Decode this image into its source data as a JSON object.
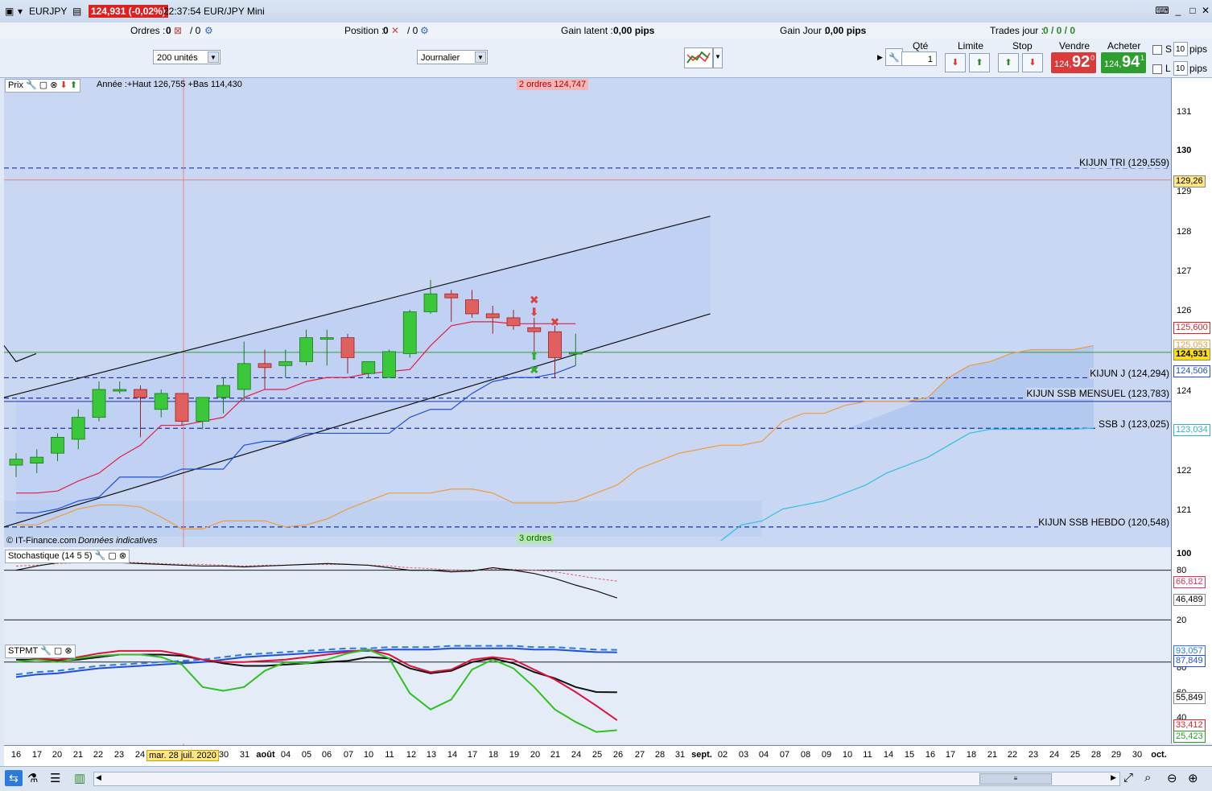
{
  "titlebar": {
    "symbol": "EURJPY",
    "price_badge": "124,931 (-0,02%)",
    "time_title": "22:37:54 EUR/JPY Mini"
  },
  "infobar": {
    "orders_label": "Ordres :",
    "orders_value": "0",
    "orders_sep": "/ 0",
    "position_label": "Position :",
    "position_value": "0",
    "position_sep": "/ 0",
    "unrealized_label": "Gain latent :",
    "unrealized_value": "0,00 pips",
    "day_gain_label": "Gain Jour :",
    "day_gain_value": "0,00 pips",
    "trades_label": "Trades jour :",
    "trades_value": "0 / 0 / 0"
  },
  "toolbar": {
    "units_select": "200 unités",
    "period_select": "Journalier",
    "qty_label": "Qté",
    "qty_value": "1",
    "limit_label": "Limite",
    "stop_label": "Stop",
    "sell_label": "Vendre",
    "buy_label": "Acheter",
    "sell_small": "124,",
    "sell_big": "92",
    "sell_sup": "0",
    "buy_small": "124,",
    "buy_big": "94",
    "buy_sup": "1",
    "s_label": "S",
    "l_label": "L",
    "s_pips": "10",
    "l_pips": "10",
    "pips_unit": "pips"
  },
  "price_panel": {
    "title": "Prix",
    "range": "Année :+Haut 126,755 +Bas 114,430",
    "orders_top": "2 ordres 124,747",
    "orders_bottom": "3 ordres",
    "copyright": "© IT-Finance.com",
    "indicative": "Données indicatives",
    "levels": [
      {
        "label": "KIJUN TRI (129,559)"
      },
      {
        "label": "KIJUN J (124,294)"
      },
      {
        "label": "KIJUN SSB MENSUEL (123,783)"
      },
      {
        "label": "SSB J (123,025)"
      },
      {
        "label": "KIJUN SSB HEBDO (120,548)"
      }
    ],
    "ticks": [
      "131",
      "130",
      "129",
      "128",
      "127",
      "126",
      "124",
      "122",
      "121"
    ],
    "badges": [
      "129,26",
      "125,600",
      "125,053",
      "124,931",
      "124,506",
      "123,034"
    ]
  },
  "stoch_panel": {
    "title": "Stochastique (14 5 5)",
    "ticks": [
      "100",
      "80",
      "20"
    ],
    "badges": [
      "66,812",
      "46,489"
    ]
  },
  "stpmt_panel": {
    "title": "STPMT",
    "ticks": [
      "80",
      "60",
      "40"
    ],
    "badges": [
      "93,057",
      "87,849",
      "55,849",
      "33,412",
      "25,423"
    ]
  },
  "dates": [
    "16",
    "17",
    "20",
    "21",
    "22",
    "23",
    "24",
    "mar. 28 juil. 2020",
    "30",
    "31",
    "août",
    "04",
    "05",
    "06",
    "07",
    "10",
    "11",
    "12",
    "13",
    "14",
    "17",
    "18",
    "19",
    "20",
    "21",
    "24",
    "25",
    "26",
    "27",
    "28",
    "31",
    "sept.",
    "02",
    "03",
    "04",
    "07",
    "08",
    "09",
    "10",
    "11",
    "14",
    "15",
    "16",
    "17",
    "18",
    "21",
    "22",
    "23",
    "24",
    "25",
    "28",
    "29",
    "30",
    "oct."
  ],
  "colors": {
    "bull": "#3ac83a",
    "bear": "#e06060",
    "kijun": "#e0204a",
    "tenkan": "#2050d8",
    "chikou": "#ef9a40",
    "ssb": "#30c0e0"
  },
  "candles": [
    {
      "o": 122.1,
      "h": 122.4,
      "l": 121.8,
      "c": 122.25
    },
    {
      "o": 122.15,
      "h": 122.5,
      "l": 121.9,
      "c": 122.3
    },
    {
      "o": 122.4,
      "h": 122.9,
      "l": 122.2,
      "c": 122.8
    },
    {
      "o": 122.75,
      "h": 123.5,
      "l": 122.5,
      "c": 123.3
    },
    {
      "o": 123.3,
      "h": 124.2,
      "l": 123.2,
      "c": 124.0
    },
    {
      "o": 124.0,
      "h": 124.2,
      "l": 123.9,
      "c": 124.0
    },
    {
      "o": 124.0,
      "h": 124.1,
      "l": 122.8,
      "c": 123.8
    },
    {
      "o": 123.5,
      "h": 124.0,
      "l": 123.3,
      "c": 123.9
    },
    {
      "o": 123.9,
      "h": 123.9,
      "l": 123.1,
      "c": 123.2
    },
    {
      "o": 123.2,
      "h": 123.8,
      "l": 123.0,
      "c": 123.8
    },
    {
      "o": 123.8,
      "h": 124.3,
      "l": 123.4,
      "c": 124.1
    },
    {
      "o": 124.0,
      "h": 125.2,
      "l": 123.7,
      "c": 124.65
    },
    {
      "o": 124.65,
      "h": 125.0,
      "l": 124.0,
      "c": 124.55
    },
    {
      "o": 124.6,
      "h": 125.0,
      "l": 124.3,
      "c": 124.7
    },
    {
      "o": 124.7,
      "h": 125.5,
      "l": 124.6,
      "c": 125.3
    },
    {
      "o": 125.3,
      "h": 125.5,
      "l": 124.6,
      "c": 125.3
    },
    {
      "o": 125.3,
      "h": 125.4,
      "l": 124.4,
      "c": 124.8
    },
    {
      "o": 124.4,
      "h": 124.6,
      "l": 124.3,
      "c": 124.7
    },
    {
      "o": 124.3,
      "h": 125.0,
      "l": 124.3,
      "c": 124.95
    },
    {
      "o": 124.9,
      "h": 126.0,
      "l": 124.8,
      "c": 125.95
    },
    {
      "o": 125.95,
      "h": 126.75,
      "l": 125.9,
      "c": 126.4
    },
    {
      "o": 126.4,
      "h": 126.5,
      "l": 125.7,
      "c": 126.3
    },
    {
      "o": 126.25,
      "h": 126.5,
      "l": 125.8,
      "c": 125.9
    },
    {
      "o": 125.9,
      "h": 126.1,
      "l": 125.4,
      "c": 125.8
    },
    {
      "o": 125.8,
      "h": 126.0,
      "l": 125.5,
      "c": 125.6
    },
    {
      "o": 125.55,
      "h": 125.8,
      "l": 124.9,
      "c": 125.45
    },
    {
      "o": 125.45,
      "h": 125.6,
      "l": 124.3,
      "c": 124.8
    },
    {
      "o": 124.93,
      "h": 125.4,
      "l": 124.6,
      "c": 124.93
    }
  ],
  "kijun": [
    121.4,
    121.4,
    121.45,
    121.7,
    121.9,
    122.3,
    122.6,
    123.1,
    123.1,
    123.2,
    123.3,
    123.8,
    124.0,
    124.0,
    124.2,
    124.3,
    124.3,
    124.4,
    124.45,
    124.5,
    125.1,
    125.6,
    125.7,
    125.7,
    125.65,
    125.65,
    125.65,
    125.65
  ],
  "tenkan": [
    120.9,
    120.9,
    121.0,
    121.2,
    121.3,
    121.8,
    121.8,
    121.8,
    122.0,
    122.0,
    122.0,
    122.6,
    122.7,
    122.7,
    122.9,
    122.9,
    122.9,
    122.9,
    122.9,
    123.3,
    123.5,
    123.5,
    123.9,
    124.2,
    124.3,
    124.3,
    124.4,
    124.6
  ],
  "chikou": [
    120.6,
    120.6,
    120.8,
    121.0,
    121.1,
    121.1,
    121.05,
    120.8,
    120.5,
    120.5,
    120.7,
    120.7,
    120.7,
    120.55,
    120.6,
    120.75,
    121.0,
    121.2,
    121.4,
    121.4,
    121.4,
    121.5,
    121.5,
    121.4,
    121.15,
    121.15,
    121.15,
    121.2,
    121.4,
    121.6,
    122.0,
    122.2,
    122.4,
    122.5,
    122.6,
    122.6,
    122.7,
    123.2,
    123.4,
    123.4,
    123.6,
    123.7,
    123.7,
    123.7,
    123.8,
    124.3,
    124.6,
    124.7,
    124.9,
    125.0,
    125.0,
    125.0,
    125.1
  ],
  "ssb": [
    null,
    null,
    null,
    null,
    null,
    null,
    null,
    null,
    null,
    null,
    null,
    null,
    null,
    null,
    null,
    null,
    null,
    null,
    null,
    null,
    null,
    null,
    null,
    null,
    null,
    null,
    null,
    null,
    null,
    null,
    null,
    null,
    null,
    null,
    120.2,
    120.6,
    120.7,
    121.0,
    121.1,
    121.2,
    121.4,
    121.6,
    121.9,
    122.1,
    122.3,
    122.6,
    122.9,
    123.0,
    123.0,
    123.0,
    123.0,
    123.0,
    123.03
  ],
  "stoch_k": [
    80,
    85,
    89,
    90,
    90,
    89,
    88,
    87,
    86,
    85,
    85,
    84,
    85,
    86,
    87,
    88,
    87,
    86,
    83,
    80,
    80,
    78,
    79,
    83,
    80,
    76,
    70,
    62,
    55,
    46.5
  ],
  "stoch_d": [
    85,
    86,
    88,
    89,
    90,
    90,
    89,
    88,
    87,
    87,
    86,
    85,
    86,
    86,
    87,
    87,
    87,
    86,
    85,
    83,
    82,
    80,
    80,
    81,
    81,
    80,
    78,
    74,
    70,
    66.8
  ],
  "stpmt_black": [
    82,
    82,
    81,
    82,
    84,
    86,
    86,
    86,
    85,
    82,
    79,
    77,
    77,
    78,
    79,
    80,
    81,
    84,
    83,
    75,
    71,
    73,
    80,
    83,
    79,
    72,
    67,
    60,
    56,
    55.8
  ],
  "stpmt_red": [
    85,
    83,
    82,
    84,
    87,
    89,
    89,
    89,
    86,
    82,
    80,
    80,
    81,
    82,
    84,
    86,
    88,
    90,
    86,
    77,
    72,
    74,
    82,
    84,
    82,
    74,
    66,
    56,
    45,
    33.4
  ],
  "stpmt_green": [
    80,
    82,
    80,
    83,
    85,
    86,
    86,
    84,
    78,
    60,
    57,
    60,
    73,
    80,
    79,
    82,
    87,
    90,
    83,
    55,
    42,
    50,
    74,
    82,
    75,
    60,
    42,
    32,
    24,
    25.4
  ],
  "stpmt_blue": [
    68,
    70,
    71,
    73,
    75,
    76,
    77,
    78,
    79,
    80,
    82,
    84,
    85,
    86,
    87,
    88,
    89,
    89,
    90,
    90,
    90,
    91,
    91,
    91,
    91,
    90,
    90,
    89,
    88,
    87.8
  ]
}
